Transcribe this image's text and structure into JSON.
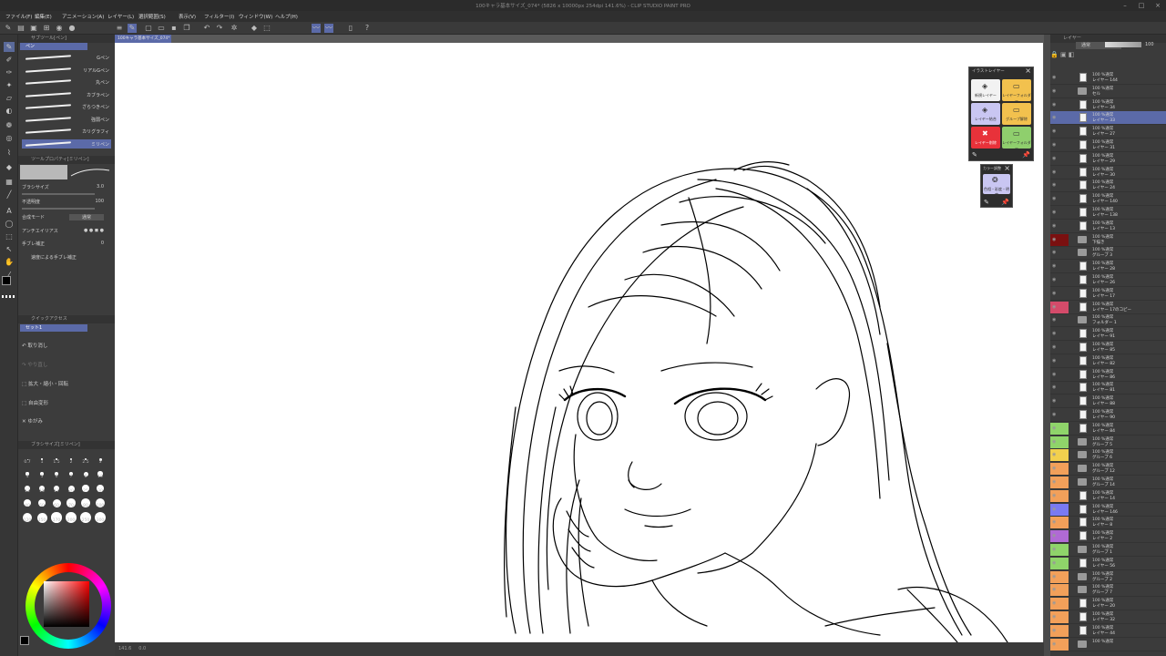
{
  "window": {
    "title": "100キャラ基本サイズ_074* (5826 x 10000px 254dpi 141.6%) - CLIP STUDIO PAINT PRO"
  },
  "menu": [
    "ファイル(F)",
    "編集(E)",
    "アニメーション(A)",
    "レイヤー(L)",
    "選択範囲(S)",
    "表示(V)",
    "フィルター(I)",
    "ウィンドウ(W)",
    "ヘルプ(H)"
  ],
  "sub_tool": {
    "header": "サブツール[ペン]",
    "tab": "ペン",
    "brushes": [
      "Gペン",
      "リアルGペン",
      "丸ペン",
      "カブラペン",
      "ざらつきペン",
      "強弱ペン",
      "カリグラフィ",
      "ミリペン"
    ],
    "selected_index": 7
  },
  "tool_property": {
    "header": "ツールプロパティ[ミリペン]",
    "brush_size_label": "ブラシサイズ",
    "brush_size_value": "3.0",
    "opacity_label": "不透明度",
    "opacity_value": "100",
    "blend_label": "合成モード",
    "blend_value": "通常",
    "antialias_label": "アンチエイリアス",
    "stabilize_label": "手ブレ補正",
    "stabilize_value": "0",
    "speed_label": "速度による手ブレ補正"
  },
  "quick_access": {
    "header": "クイックアクセス",
    "tab": "セット1",
    "items": [
      "取り消し",
      "やり直し",
      "拡大・縮小・回転",
      "自由変形",
      "ゆがみ"
    ]
  },
  "brush_size_palette": {
    "header": "ブラシサイズ[ミリペン]",
    "sizes": [
      "0.7",
      "1",
      "1.5",
      "2",
      "2.5",
      "3",
      "4",
      "5",
      "6",
      "7",
      "8",
      "10",
      "12",
      "15",
      "17",
      "20",
      "25",
      "30",
      "40",
      "50",
      "60",
      "70",
      "80",
      "100",
      "120",
      "150",
      "170",
      "200",
      "250",
      "300"
    ]
  },
  "document_tab": "100キャラ基本サイズ_074*",
  "canvas_status": {
    "zoom": "141.6",
    "angle": "0.0"
  },
  "layer_panel": {
    "header": "レイヤー",
    "blend_mode": "通常",
    "opacity": "100",
    "layers": [
      {
        "type": "paper",
        "blend": "100 %通常",
        "name": "レイヤー 144"
      },
      {
        "type": "folder",
        "blend": "100 %通常",
        "name": "セル"
      },
      {
        "type": "layer",
        "blend": "100 %通常",
        "name": "レイヤー 34"
      },
      {
        "type": "layer",
        "blend": "100 %通常",
        "name": "レイヤー 33",
        "selected": true
      },
      {
        "type": "layer",
        "blend": "100 %通常",
        "name": "レイヤー 27"
      },
      {
        "type": "layer",
        "blend": "100 %通常",
        "name": "レイヤー 31"
      },
      {
        "type": "layer",
        "blend": "100 %通常",
        "name": "レイヤー 29"
      },
      {
        "type": "layer",
        "blend": "100 %通常",
        "name": "レイヤー 30"
      },
      {
        "type": "layer",
        "blend": "100 %通常",
        "name": "レイヤー 24"
      },
      {
        "type": "layer",
        "blend": "100 %通常",
        "name": "レイヤー 140"
      },
      {
        "type": "layer",
        "blend": "100 %通常",
        "name": "レイヤー 138"
      },
      {
        "type": "layer",
        "blend": "100 %通常",
        "name": "レイヤー 13"
      },
      {
        "type": "folder",
        "blend": "100 %通常",
        "name": "下描き"
      },
      {
        "type": "folder",
        "blend": "100 %通常",
        "name": "グループ 3"
      },
      {
        "type": "layer",
        "blend": "100 %通常",
        "name": "レイヤー 28"
      },
      {
        "type": "layer",
        "blend": "100 %通常",
        "name": "レイヤー 26"
      },
      {
        "type": "layer",
        "blend": "100 %通常",
        "name": "レイヤー 17"
      },
      {
        "type": "layer",
        "blend": "100 %通常",
        "name": "レイヤー 17のコピー"
      },
      {
        "type": "folder",
        "blend": "100 %通常",
        "name": "フォルダー 1"
      },
      {
        "type": "layer",
        "blend": "100 %通常",
        "name": "レイヤー 91"
      },
      {
        "type": "layer",
        "blend": "100 %通常",
        "name": "レイヤー 85"
      },
      {
        "type": "layer",
        "blend": "100 %通常",
        "name": "レイヤー 82"
      },
      {
        "type": "layer",
        "blend": "100 %通常",
        "name": "レイヤー 86"
      },
      {
        "type": "layer",
        "blend": "100 %通常",
        "name": "レイヤー 81"
      },
      {
        "type": "layer",
        "blend": "100 %通常",
        "name": "レイヤー 88"
      },
      {
        "type": "layer",
        "blend": "100 %通常",
        "name": "レイヤー 90"
      },
      {
        "type": "layer",
        "blend": "100 %通常",
        "name": "レイヤー 84"
      },
      {
        "type": "folder",
        "blend": "100 %通常",
        "name": "グループ 5"
      },
      {
        "type": "folder",
        "blend": "100 %通常",
        "name": "グループ 6"
      },
      {
        "type": "folder",
        "blend": "100 %通常",
        "name": "グループ 12"
      },
      {
        "type": "folder",
        "blend": "100 %通常",
        "name": "グループ 14"
      },
      {
        "type": "layer",
        "blend": "100 %通常",
        "name": "レイヤー 14"
      },
      {
        "type": "layer",
        "blend": "100 %通常",
        "name": "レイヤー 146"
      },
      {
        "type": "layer",
        "blend": "100 %通常",
        "name": "レイヤー 8"
      },
      {
        "type": "layer",
        "blend": "100 %通常",
        "name": "レイヤー 2"
      },
      {
        "type": "folder",
        "blend": "100 %通常",
        "name": "グループ 1"
      },
      {
        "type": "layer",
        "blend": "100 %通常",
        "name": "レイヤー 56"
      },
      {
        "type": "folder",
        "blend": "100 %通常",
        "name": "グループ 2"
      },
      {
        "type": "folder",
        "blend": "100 %通常",
        "name": "グループ 7"
      },
      {
        "type": "layer",
        "blend": "100 %通常",
        "name": "レイヤー 20"
      },
      {
        "type": "layer",
        "blend": "100 %通常",
        "name": "レイヤー 32"
      },
      {
        "type": "layer",
        "blend": "100 %通常",
        "name": "レイヤー 44"
      },
      {
        "type": "folder",
        "blend": "100 %通常",
        "name": ""
      }
    ]
  },
  "illust_layer_palette": {
    "title": "イラストレイヤー",
    "buttons": [
      "新規レイヤー",
      "レイヤーフォルダー",
      "レイヤー結合",
      "グループ解除",
      "レイヤー削除",
      "レイヤーフォルダー"
    ]
  },
  "sub_palette": {
    "title": "カラー調整",
    "button": "色相・彩度・明度"
  },
  "colors": {
    "accent": "#5b6aa8",
    "main_color": "#000000",
    "sub_color": "#ffffff"
  }
}
